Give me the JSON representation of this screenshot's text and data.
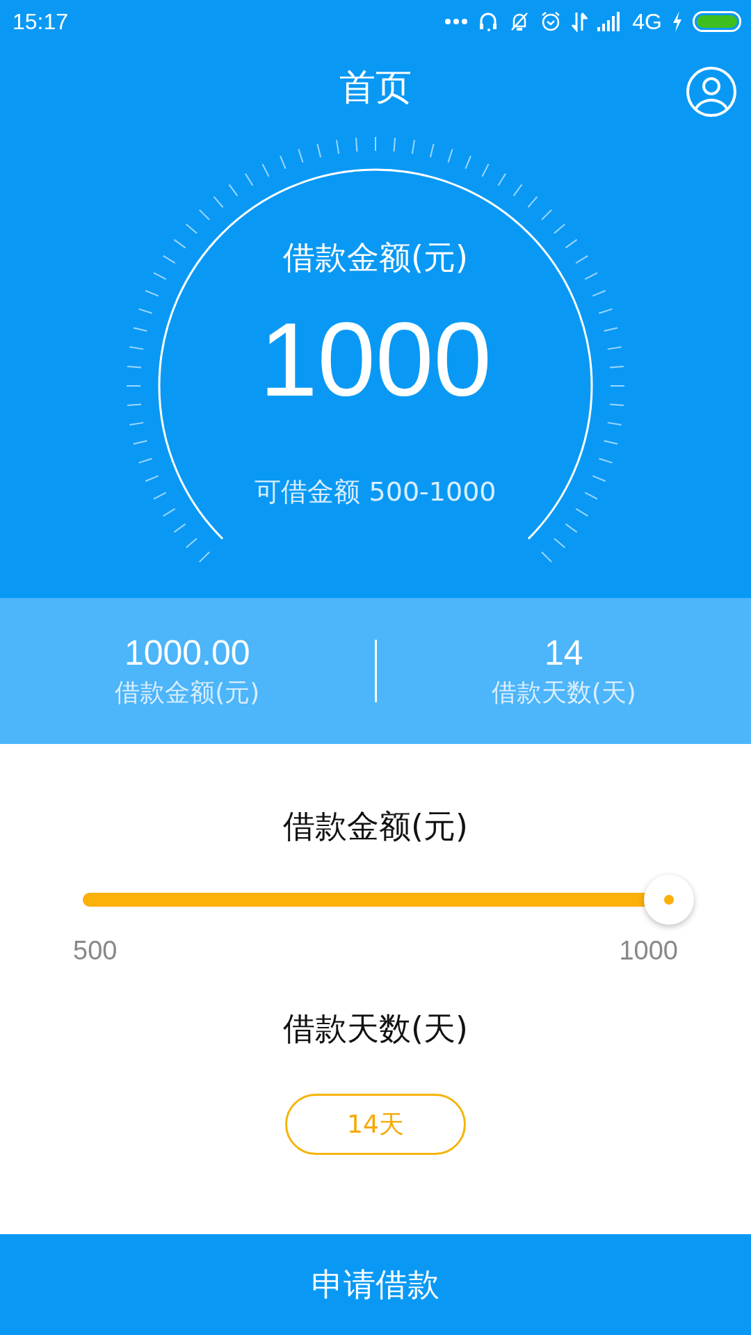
{
  "status_bar": {
    "time": "15:17",
    "network": "4G"
  },
  "header": {
    "title": "首页"
  },
  "dial": {
    "label": "借款金额(元)",
    "amount": "1000",
    "range": "可借金额 500-1000"
  },
  "summary": [
    {
      "value": "1000.00",
      "label": "借款金额(元)"
    },
    {
      "value": "14",
      "label": "借款天数(天)"
    }
  ],
  "amount_slider": {
    "title": "借款金额(元)",
    "level": 1,
    "min_label": "500",
    "max_label": "1000"
  },
  "days": {
    "title": "借款天数(天)",
    "options": [
      {
        "label": "14天",
        "selected": true
      }
    ]
  },
  "apply_button": "申请借款"
}
